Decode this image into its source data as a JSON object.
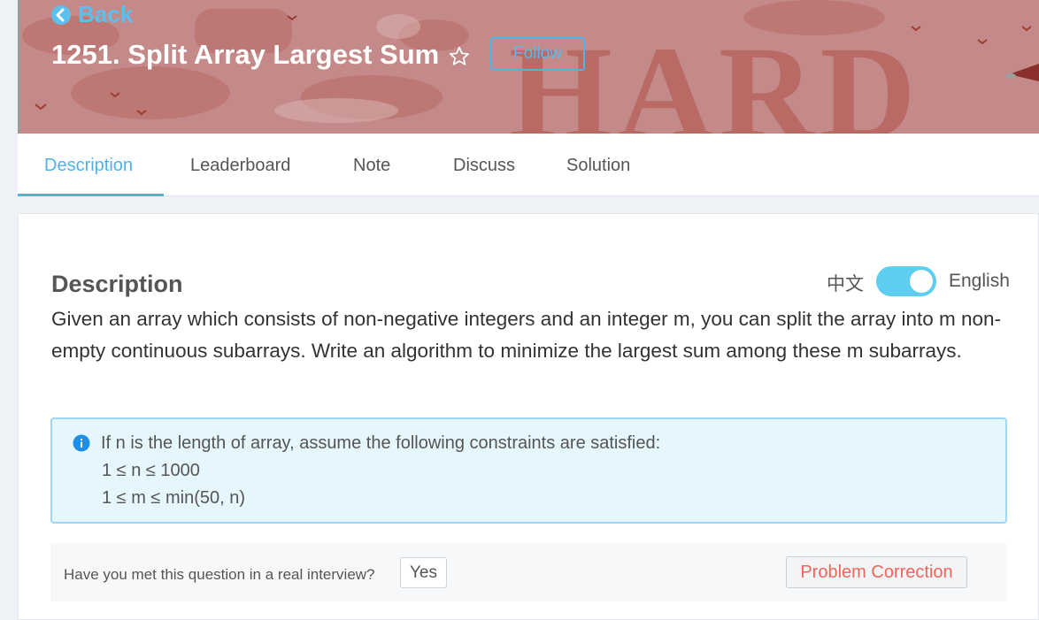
{
  "header": {
    "back_label": "Back",
    "title": "1251. Split Array Largest Sum",
    "follow_label": "Follow",
    "difficulty_watermark": "HARD"
  },
  "tabs": [
    {
      "label": "Description",
      "active": true
    },
    {
      "label": "Leaderboard",
      "active": false
    },
    {
      "label": "Note",
      "active": false
    },
    {
      "label": "Discuss",
      "active": false
    },
    {
      "label": "Solution",
      "active": false
    }
  ],
  "content": {
    "heading": "Description",
    "lang_cn": "中文",
    "lang_en": "English",
    "language_toggle_on": true,
    "description": "Given an array which consists of non-negative integers and an integer m, you can split the array into m non-empty continuous subarrays. Write an algorithm to minimize the largest sum among these m subarrays.",
    "constraints": {
      "intro": "If n is the length of array, assume the following constraints are satisfied:",
      "lines": [
        "1 ≤ n ≤ 1000",
        "1 ≤ m ≤ min(50, n)"
      ]
    }
  },
  "footer": {
    "interview_question": "Have you met this question in a real interview?",
    "yes_label": "Yes",
    "correction_label": "Problem Correction"
  },
  "icons": {
    "back": "back-circle-icon",
    "star": "star-outline-icon",
    "info": "info-circle-icon"
  },
  "colors": {
    "banner": "#c48a89",
    "accent": "#4fb3e8",
    "correction": "#f0645a"
  }
}
